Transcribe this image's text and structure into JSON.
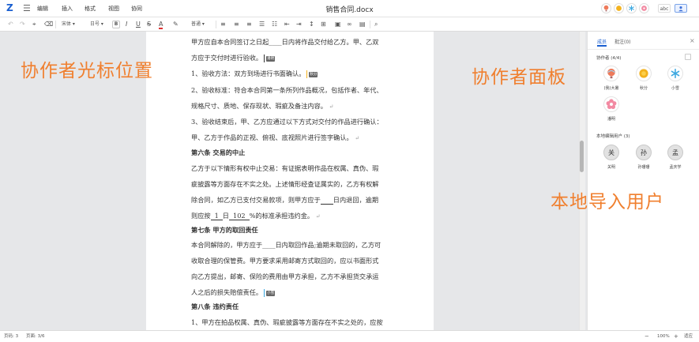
{
  "colors": {
    "accent": "#1a5fd0",
    "overlay": "#f07f2e"
  },
  "topbar": {
    "logo": "Z",
    "menu_icon": "☰",
    "menus": [
      "编辑",
      "插入",
      "格式",
      "视图",
      "协同"
    ],
    "doc_title": "销售合同.docx",
    "button_label": "abc"
  },
  "toolbar": {
    "font": "宋体",
    "size": "日号",
    "style": "普通"
  },
  "document": {
    "lines": [
      "甲方应自本合同签订之日起____日内将作品交付给乙方。甲、乙双",
      "方应于交付时进行验收。",
      "1、验收方法：双方到场进行书面确认。",
      "2、验收标准：符合本合同第一条所列作品概况，包括作者、年代、",
      "规格尺寸、质地、保存现状、瑕疵及备注内容。",
      "3、验收结束后，甲、乙方应通过以下方式对交付的作品进行确认：",
      "甲、乙方于作品的正视、俯视、底视照片进行签字确认。",
      "第六条  交易的中止",
      "乙方于以下情形有权中止交易：有证据表明作品在权属、真伪、瑕",
      "疵披露等方面存在不实之处。上述情形经查证属实的，乙方有权解",
      "除合同，如乙方已支付交易款项，则甲方应于",
      "日内退回，逾期",
      "则应按",
      "1",
      "日",
      "102",
      "%的标准承担违约金。",
      "第七条  甲方的取回责任",
      "本合同解除的，甲方应于____日内取回作品;逾期未取回的，乙方可",
      "收取合理的保管费。甲方要求采用邮寄方式取回的，应以书面形式",
      "向乙方提出，邮寄、保险的费用由甲方承担，乙方不承担货交承运",
      "人之后的损失赔偿责任。",
      "第八条  违约责任",
      "1、甲方在拍品权属、真伪、瑕疵披露等方面存在不实之处的，应按"
    ],
    "cursor_tags": [
      "潘明",
      "秋分",
      "小雪"
    ]
  },
  "panel": {
    "tabs": [
      "成员",
      "批注(0)"
    ],
    "collaborators_title": "协作者 (4/4)",
    "collaborators": [
      {
        "name": "(我)大暑",
        "icon": "hot-air-balloon-icon"
      },
      {
        "name": "秋分",
        "icon": "sun-icon"
      },
      {
        "name": "小雪",
        "icon": "snowflake-icon"
      },
      {
        "name": "潘明",
        "icon": "flower-icon"
      }
    ],
    "local_title": "本地编辑用户 (3)",
    "local_users": [
      {
        "initial": "关",
        "name": "关明"
      },
      {
        "initial": "孙",
        "name": "孙珊珊"
      },
      {
        "initial": "孟",
        "name": "孟庆学"
      }
    ]
  },
  "status": {
    "page": "页码: 3",
    "pages": "页面: 3/6",
    "zoom": "100%",
    "fit": "适应"
  },
  "overlays": {
    "cursor_label": "协作者光标位置",
    "panel_label": "协作者面板",
    "import_label": "本地导入用户"
  }
}
